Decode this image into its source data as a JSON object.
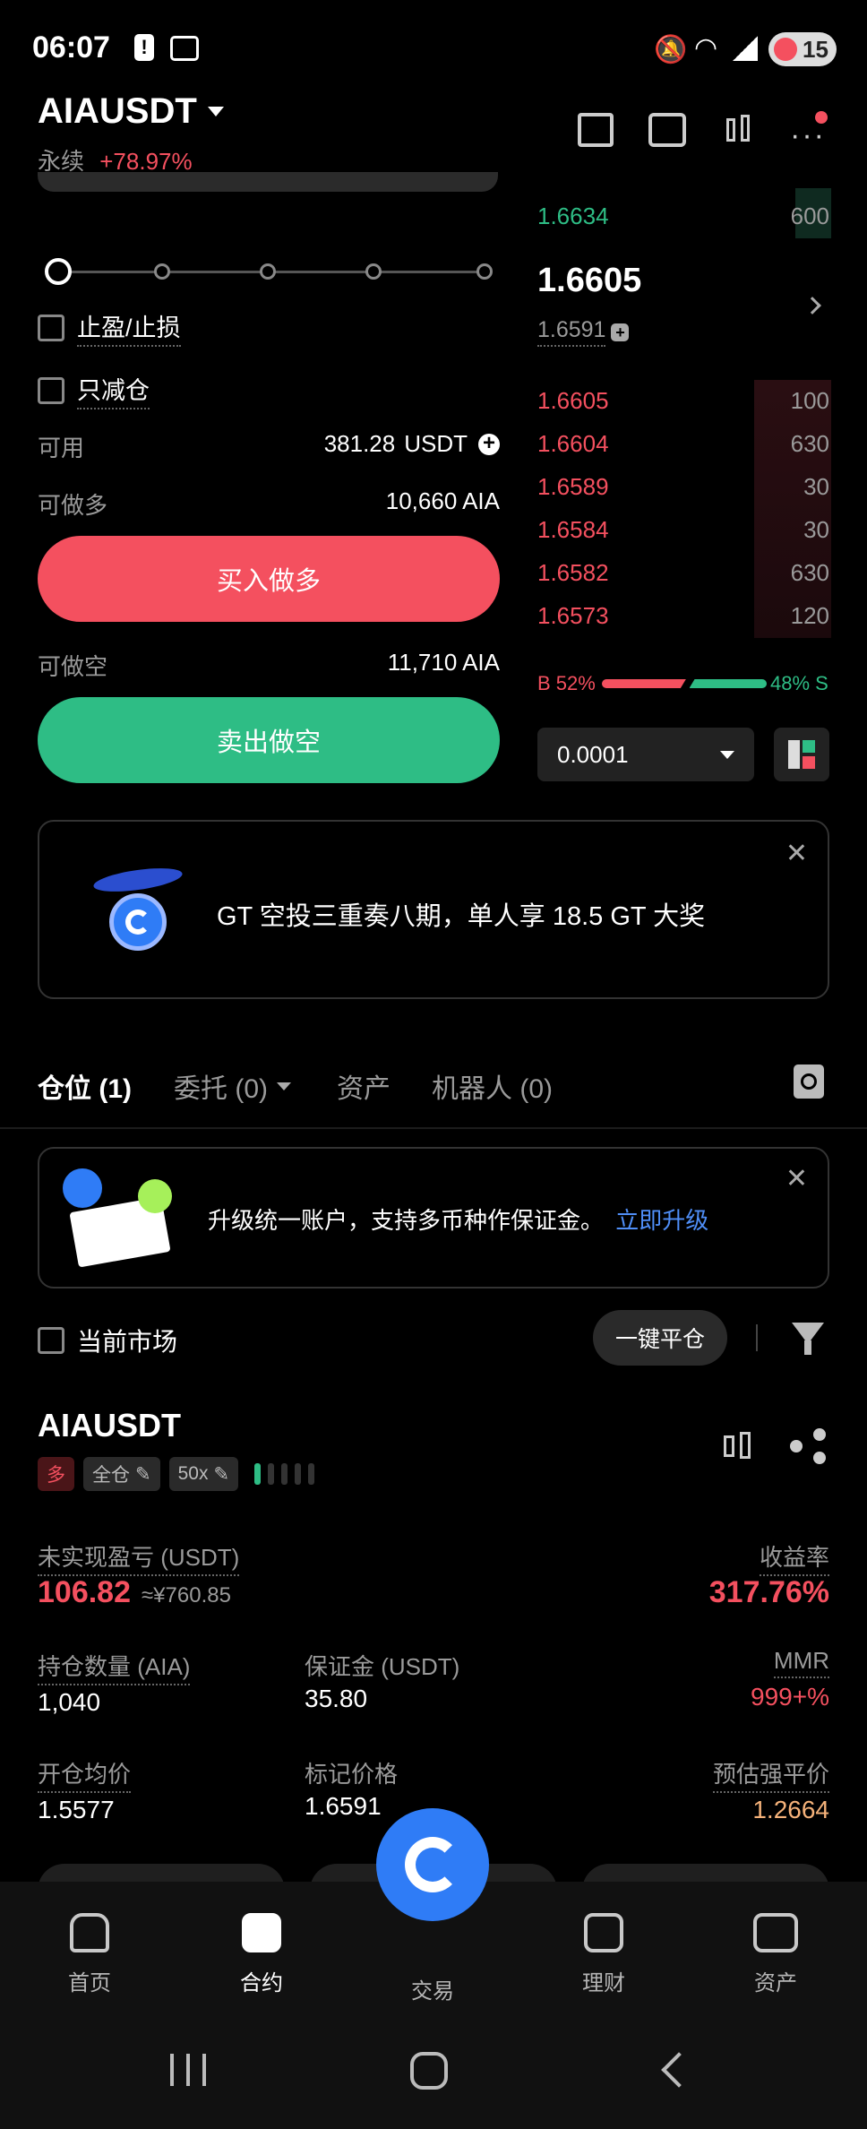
{
  "status_bar": {
    "time": "06:07",
    "battery": "15"
  },
  "header": {
    "symbol": "AIAUSDT",
    "type_label": "永续",
    "change": "+78.97%"
  },
  "form": {
    "tp_sl_label": "止盈/止损",
    "reduce_only_label": "只减仓",
    "available_label": "可用",
    "available_value": "381.28",
    "available_unit": "USDT",
    "can_long_label": "可做多",
    "can_long_value": "10,660 AIA",
    "buy_button": "买入做多",
    "can_short_label": "可做空",
    "can_short_value": "11,710 AIA",
    "sell_button": "卖出做空"
  },
  "orderbook": {
    "top_ask": {
      "price": "1.6634",
      "qty": "600"
    },
    "last_price": "1.6605",
    "mark_price": "1.6591",
    "bids": [
      {
        "price": "1.6605",
        "qty": "100"
      },
      {
        "price": "1.6604",
        "qty": "630"
      },
      {
        "price": "1.6589",
        "qty": "30"
      },
      {
        "price": "1.6584",
        "qty": "30"
      },
      {
        "price": "1.6582",
        "qty": "630"
      },
      {
        "price": "1.6573",
        "qty": "120"
      }
    ],
    "buy_ratio": "B 52%",
    "sell_ratio": "48% S",
    "buy_fraction": 0.52,
    "precision": "0.0001"
  },
  "promo": {
    "text": "GT 空投三重奏八期，单人享 18.5 GT 大奖"
  },
  "tabs": {
    "positions": "仓位 (1)",
    "orders": "委托 (0)",
    "assets": "资产",
    "bots": "机器人 (0)"
  },
  "upgrade": {
    "text": "升级统一账户，支持多币种作保证金。",
    "link": "立即升级"
  },
  "filter": {
    "current_market": "当前市场",
    "close_all": "一键平仓"
  },
  "position": {
    "symbol": "AIAUSDT",
    "side": "多",
    "margin_mode": "全仓",
    "leverage": "50x",
    "pnl_label": "未实现盈亏 (USDT)",
    "pnl_value": "106.82",
    "pnl_cny": "≈¥760.85",
    "roe_label": "收益率",
    "roe_value": "317.76%",
    "size_label": "持仓数量 (AIA)",
    "size_value": "1,040",
    "margin_label": "保证金 (USDT)",
    "margin_value": "35.80",
    "mmr_label": "MMR",
    "mmr_value": "999+%",
    "entry_label": "开仓均价",
    "entry_value": "1.5577",
    "mark_label": "标记价格",
    "mark_value": "1.6591",
    "liq_label": "预估强平价",
    "liq_value": "1.2664"
  },
  "bottom_nav": {
    "home": "首页",
    "futures": "合约",
    "trade": "交易",
    "earn": "理财",
    "assets": "资产"
  },
  "colors": {
    "red": "#f4505f",
    "green": "#2ebd85",
    "blue": "#2f7cf6"
  }
}
